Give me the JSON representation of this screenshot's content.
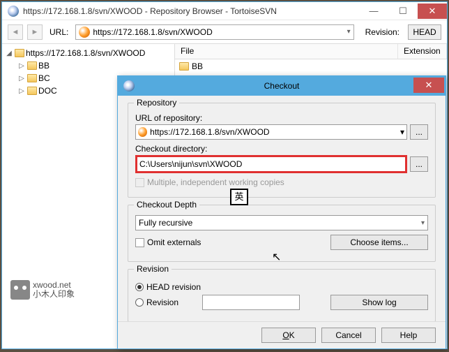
{
  "main": {
    "title": "https://172.168.1.8/svn/XWOOD - Repository Browser - TortoiseSVN",
    "url_label": "URL:",
    "url_value": "https://172.168.1.8/svn/XWOOD",
    "rev_label": "Revision:",
    "head_btn": "HEAD"
  },
  "tree": {
    "root": "https://172.168.1.8/svn/XWOOD",
    "items": [
      "BB",
      "BC",
      "DOC"
    ]
  },
  "filelist": {
    "cols": {
      "file": "File",
      "ext": "Extension"
    },
    "row0": "BB"
  },
  "wm": {
    "site": "xwood.net",
    "sub": "小木人印象"
  },
  "dlg": {
    "title": "Checkout",
    "grp_repo": "Repository",
    "url_lbl": "URL of repository:",
    "url_val": "https://172.168.1.8/svn/XWOOD",
    "dir_lbl": "Checkout directory:",
    "dir_val": "C:\\Users\\nijun\\svn\\XWOOD",
    "multi": "Multiple, independent working copies",
    "grp_depth": "Checkout Depth",
    "depth_val": "Fully recursive",
    "omit": "Omit externals",
    "choose": "Choose items...",
    "grp_rev": "Revision",
    "head": "HEAD revision",
    "rev": "Revision",
    "showlog": "Show log",
    "ok": "OK",
    "cancel": "Cancel",
    "help": "Help"
  },
  "ime": "英"
}
